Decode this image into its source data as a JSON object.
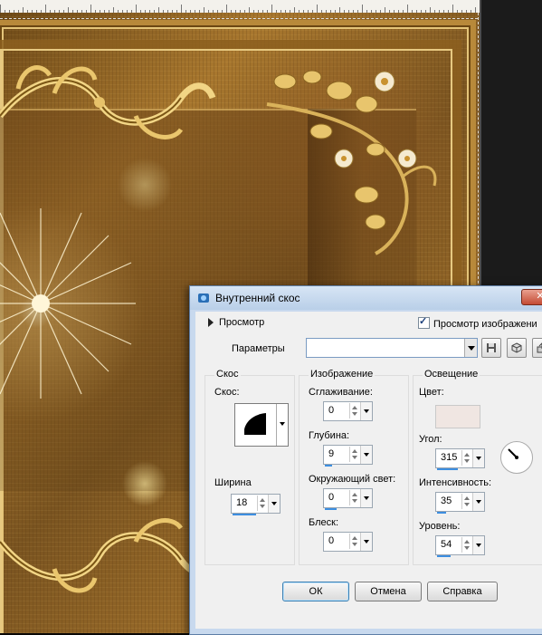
{
  "dialog": {
    "title": "Внутренний скос",
    "close_label": "✕",
    "preview_label": "Просмотр",
    "preview_image_label": "Просмотр изображени",
    "preview_image_checked": true,
    "params_label": "Параметры",
    "params_value": ""
  },
  "bevel": {
    "group_title": "Скос",
    "bevel_label": "Скос:",
    "width_label": "Ширина",
    "width_value": "18"
  },
  "image": {
    "group_title": "Изображение",
    "smoothing_label": "Сглаживание:",
    "smoothing_value": "0",
    "depth_label": "Глубина:",
    "depth_value": "9",
    "ambience_label": "Окружающий свет:",
    "ambience_value": "0",
    "shininess_label": "Блеск:",
    "shininess_value": "0"
  },
  "light": {
    "group_title": "Освещение",
    "color_label": "Цвет:",
    "color_value": "#f0e6e2",
    "angle_label": "Угол:",
    "angle_value": "315",
    "intensity_label": "Интенсивность:",
    "intensity_value": "35",
    "elevation_label": "Уровень:",
    "elevation_value": "54"
  },
  "buttons": {
    "ok": "ОК",
    "cancel": "Отмена",
    "help": "Справка"
  },
  "colors": {
    "accent": "#3d8ee0",
    "gold": "#b8893a"
  }
}
